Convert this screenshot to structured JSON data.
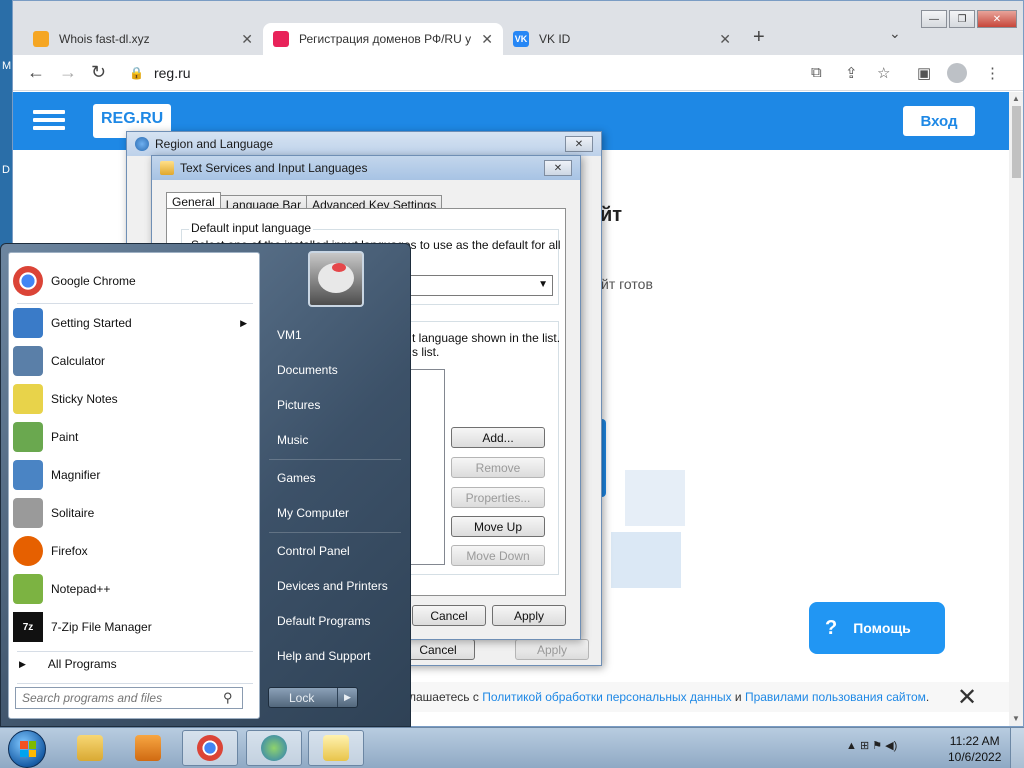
{
  "desktop": {
    "frag1": "M",
    "frag2": "D"
  },
  "chrome": {
    "tabs": [
      {
        "title": "Whois fast-dl.xyz",
        "icon_color": "#f5a623"
      },
      {
        "title": "Регистрация доменов РФ/RU у",
        "icon_color": "#e8235a"
      },
      {
        "title": "VK ID",
        "icon_color": "#2787f5",
        "icon_text": "VK"
      }
    ],
    "tab_close": "✕",
    "new_tab": "+",
    "tab_menu": "⌄",
    "window_buttons": {
      "minimize": "—",
      "restore": "❐",
      "close": "✕"
    },
    "nav": {
      "back": "←",
      "forward": "→",
      "reload": "↻"
    },
    "url": "reg.ru",
    "toolbar_icons": {
      "translate": "⧉",
      "share": "⇪",
      "bookmark": "☆",
      "sidepanel": "▣",
      "menu": "⋮"
    }
  },
  "site": {
    "logo": "REG.RU",
    "login": "Вход",
    "heading_fragment": "йт",
    "text_fragment": "йт готов",
    "help": "Помощь",
    "help_icon": "?",
    "cookie": {
      "prefix": "лашаетесь с ",
      "link1": "Политикой обработки персональных данных",
      "middle": " и ",
      "link2": "Правилами пользования сайтом",
      "suffix": "."
    },
    "cookie_close": "✕",
    "scroll_up": "▲",
    "scroll_down": "▼"
  },
  "region_dialog": {
    "title": "Region and Language",
    "close": "✕",
    "cancel": "Cancel",
    "apply": "Apply"
  },
  "text_services_dialog": {
    "title": "Text Services and Input Languages",
    "close": "✕",
    "tabs": [
      "General",
      "Language Bar",
      "Advanced Key Settings"
    ],
    "default_input_label": "Default input language",
    "default_input_desc": "Select one of the installed input languages to use as the default for all input",
    "combo_arrow": "▼",
    "installed_desc1": "t language shown in the list.",
    "installed_desc2": "s list.",
    "buttons": {
      "add": "Add...",
      "remove": "Remove",
      "properties": "Properties...",
      "move_up": "Move Up",
      "move_down": "Move Down"
    },
    "cancel": "Cancel",
    "apply": "Apply"
  },
  "start_menu": {
    "programs": [
      {
        "name": "Google Chrome",
        "color": "#db4437"
      },
      {
        "name": "Getting Started",
        "color": "#3a7bc8",
        "submenu": "▶"
      },
      {
        "name": "Calculator",
        "color": "#5a7fa8"
      },
      {
        "name": "Sticky Notes",
        "color": "#e8d34a"
      },
      {
        "name": "Paint",
        "color": "#6aa84f"
      },
      {
        "name": "Magnifier",
        "color": "#4a84c4"
      },
      {
        "name": "Solitaire",
        "color": "#9a9a9a"
      },
      {
        "name": "Firefox",
        "color": "#e66000"
      },
      {
        "name": "Notepad++",
        "color": "#7cb342"
      },
      {
        "name": "7-Zip File Manager",
        "color": "#111111",
        "icon_text": "7z"
      }
    ],
    "all_programs": "All Programs",
    "all_programs_arrow": "▶",
    "search_placeholder": "Search programs and files",
    "search_icon": "⚲",
    "right_items": [
      "VM1",
      "Documents",
      "Pictures",
      "Music",
      "Games",
      "My Computer",
      "Control Panel",
      "Devices and Printers",
      "Default Programs",
      "Help and Support"
    ],
    "lock": "Lock",
    "lock_arrow": "▶"
  },
  "taskbar": {
    "tray": "▲  ⊞  ⚑  ◀)",
    "time": "11:22 AM",
    "date": "10/6/2022"
  }
}
